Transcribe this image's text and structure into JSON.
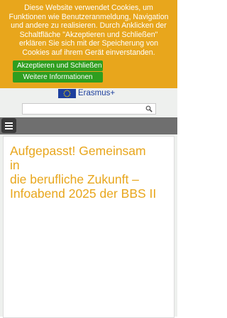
{
  "cookie_banner": {
    "lines": [
      "Diese Website verwendet Cookies, um",
      "Funktionen wie Benutzeranmeldung, Navigation",
      "und andere zu realisieren. Durch Anklicken der",
      "Schaltfläche \"Akzeptieren und Schließen\"",
      "erklären Sie sich mit der Speicherung von",
      "Cookies auf ihrem Gerät einverstanden."
    ],
    "accept_label": "Akzeptieren und Schließen",
    "more_info_label": "Weitere Informationen"
  },
  "header": {
    "erasmus_label": "Erasmus+"
  },
  "search": {
    "value": "",
    "placeholder": ""
  },
  "article": {
    "headline_lines": [
      "Aufgepasst! Gemeinsam in",
      "die berufliche Zukunft –",
      "Infoabend 2025 der BBS II"
    ]
  },
  "colors": {
    "banner": "#e8a61c",
    "button": "#2f9e1f",
    "eu_blue": "#1d3f9e",
    "navbar": "#6f6f6f",
    "headline": "#e8a61c"
  }
}
